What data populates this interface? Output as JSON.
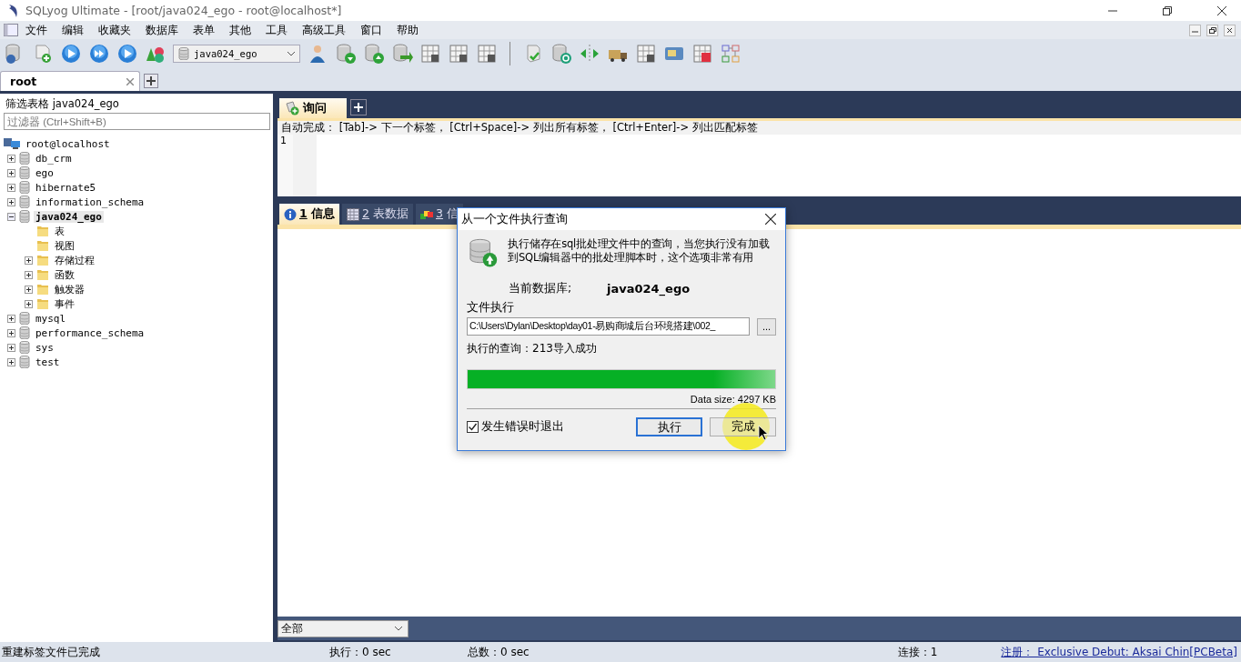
{
  "window": {
    "title": "SQLyog Ultimate - [root/java024_ego - root@localhost*]"
  },
  "menu": [
    "文件",
    "编辑",
    "收藏夹",
    "数据库",
    "表单",
    "其他",
    "工具",
    "高级工具",
    "窗口",
    "帮助"
  ],
  "toolbar": {
    "database_select": "java024_ego"
  },
  "connection_tabs": [
    {
      "label": "root",
      "selected": true
    }
  ],
  "object_browser": {
    "heading": "筛选表格 java024_ego",
    "filter": {
      "placeholder": "过滤器 (Ctrl+Shift+B)"
    },
    "tree": [
      {
        "label": "root@localhost",
        "kind": "server",
        "selected": false,
        "children": [
          {
            "label": "db_crm",
            "kind": "database",
            "expanded": false,
            "selected": false
          },
          {
            "label": "ego",
            "kind": "database",
            "expanded": false,
            "selected": false
          },
          {
            "label": "hibernate5",
            "kind": "database",
            "expanded": false,
            "selected": false
          },
          {
            "label": "information_schema",
            "kind": "database",
            "expanded": false,
            "selected": false
          },
          {
            "label": "java024_ego",
            "kind": "database",
            "expanded": true,
            "selected": true,
            "children": [
              {
                "label": "表",
                "kind": "folder",
                "selected": false
              },
              {
                "label": "视图",
                "kind": "folder",
                "selected": false
              },
              {
                "label": "存储过程",
                "kind": "folder",
                "expanded": false,
                "selected": false
              },
              {
                "label": "函数",
                "kind": "folder",
                "expanded": false,
                "selected": false
              },
              {
                "label": "触发器",
                "kind": "folder",
                "expanded": false,
                "selected": false
              },
              {
                "label": "事件",
                "kind": "folder",
                "expanded": false,
                "selected": false
              }
            ]
          },
          {
            "label": "mysql",
            "kind": "database",
            "expanded": false,
            "selected": false
          },
          {
            "label": "performance_schema",
            "kind": "database",
            "expanded": false,
            "selected": false
          },
          {
            "label": "sys",
            "kind": "database",
            "expanded": false,
            "selected": false
          },
          {
            "label": "test",
            "kind": "database",
            "expanded": false,
            "selected": false
          }
        ]
      }
    ]
  },
  "query_tabs": [
    {
      "label": "询问",
      "selected": true
    }
  ],
  "editor": {
    "hint": "自动完成： [Tab]-> 下一个标签， [Ctrl+Space]-> 列出所有标签， [Ctrl+Enter]-> 列出匹配标签",
    "line_numbers": [
      "1"
    ]
  },
  "result_tabs": [
    {
      "number": "1",
      "label": "信息",
      "kind": "info",
      "selected": true
    },
    {
      "number": "2",
      "label": "表数据",
      "kind": "table",
      "selected": false
    },
    {
      "number": "3",
      "label": "信",
      "kind": "shapes",
      "selected": false
    }
  ],
  "result_filter": "全部",
  "dialog": {
    "title": "从一个文件执行查询",
    "description": "执行储存在sql批处理文件中的查询，当您执行没有加载到SQL编辑器中的批处理脚本时，这个选项非常有用",
    "database_label": "当前数据库;",
    "database": "java024_ego",
    "file_label": "文件执行",
    "file_path": "C:\\Users\\Dylan\\Desktop\\day01-易购商城后台环境搭建\\002_",
    "browse": "...",
    "status": "执行的查询：213导入成功",
    "progress": {
      "level": 1
    },
    "data_size": "Data size: 4297 KB",
    "abort_on_error": {
      "label": "发生错误时退出",
      "checked": true
    },
    "buttons": [
      {
        "label": "执行",
        "focused": true
      },
      {
        "label": "完成",
        "focused": false
      }
    ]
  },
  "status_bar": {
    "message": "重建标签文件已完成",
    "execution": "执行：0 sec",
    "total": "总数：0 sec",
    "connections": "连接：1",
    "registration": "注册：  Exclusive Debut: Aksai Chin[PCBeta]"
  }
}
